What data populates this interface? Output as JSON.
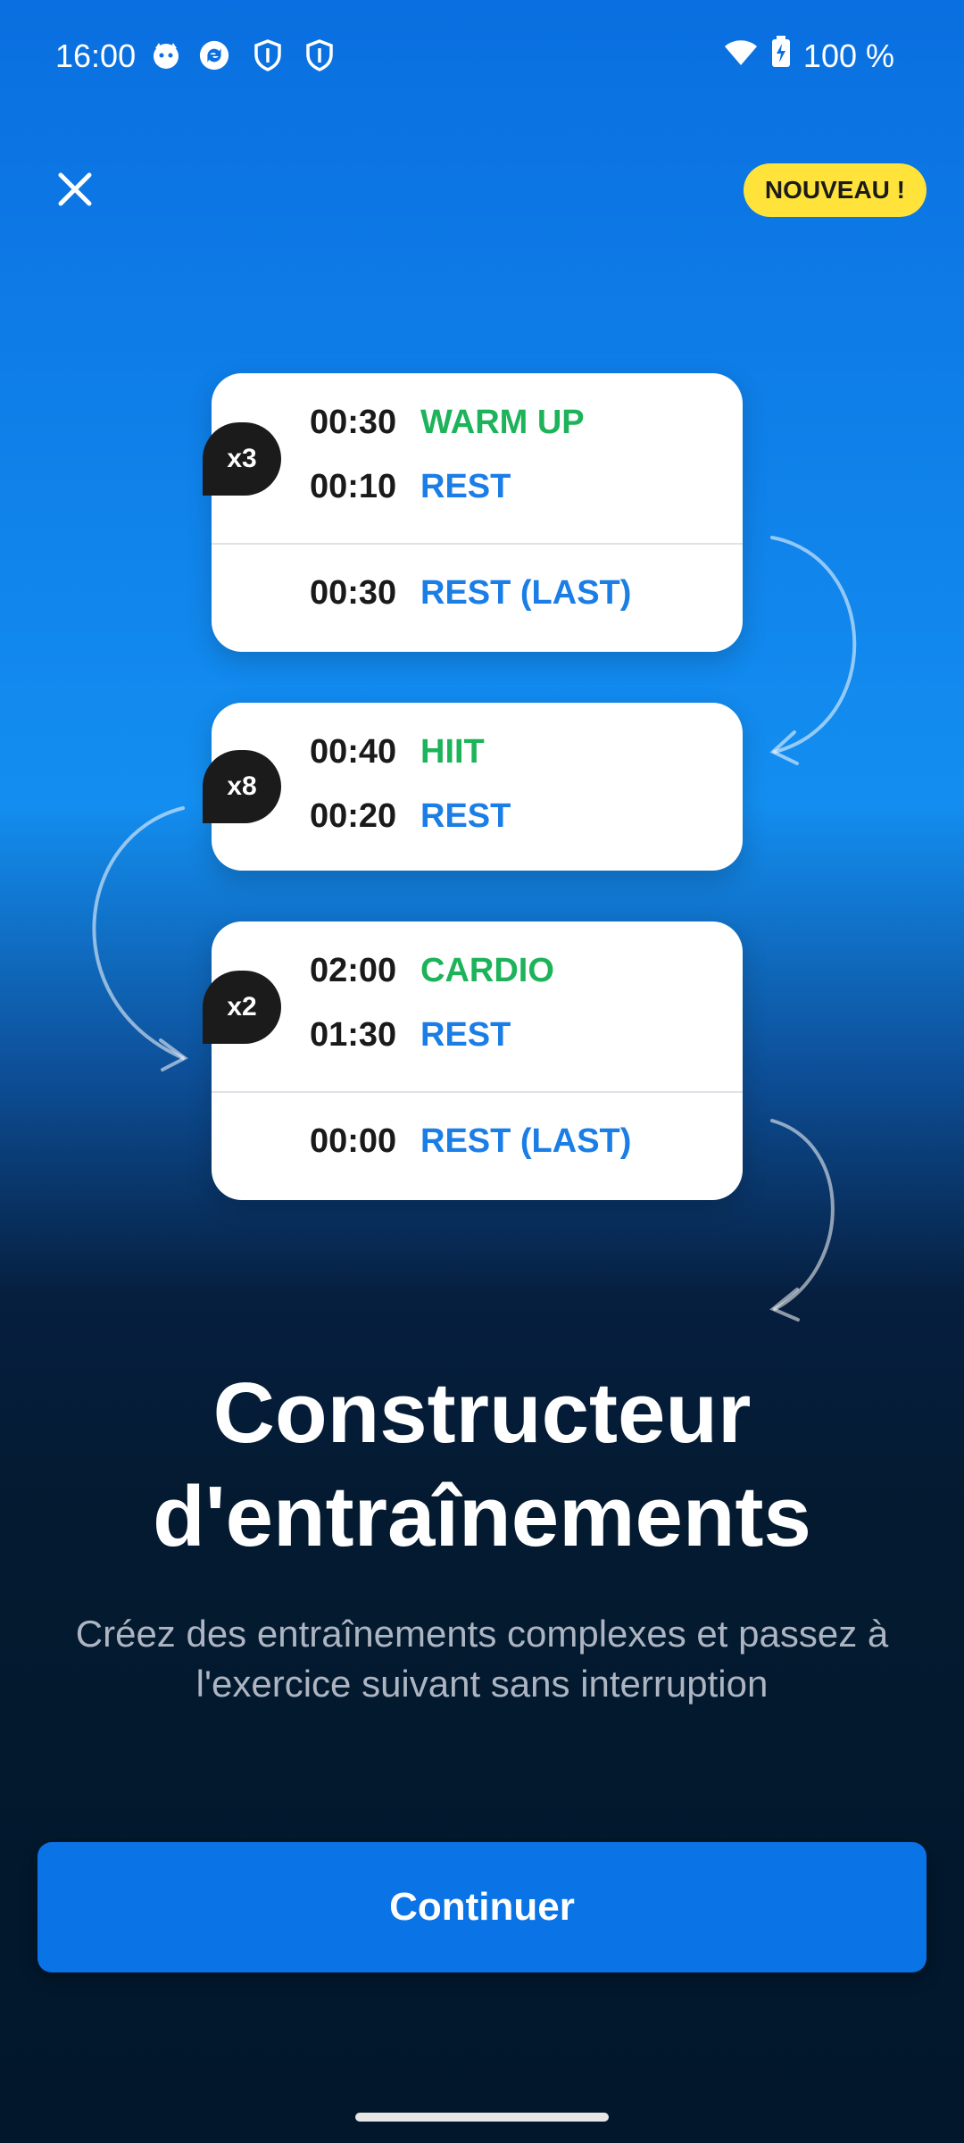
{
  "status_bar": {
    "time": "16:00",
    "battery": "100 %",
    "icons": [
      "cat-notification-icon",
      "sync-icon",
      "shield-icon",
      "shield-icon",
      "wifi-icon",
      "battery-charging-icon"
    ]
  },
  "header": {
    "badge": "NOUVEAU !",
    "close_icon": "close-icon"
  },
  "workout_cards": [
    {
      "repeat": "x3",
      "rows": [
        {
          "time": "00:30",
          "label": "WARM UP",
          "color": "#1db35a"
        },
        {
          "time": "00:10",
          "label": "REST",
          "color": "#1b7ee6"
        }
      ],
      "last": {
        "time": "00:30",
        "label": "REST (LAST)",
        "color": "#1b7ee6"
      }
    },
    {
      "repeat": "x8",
      "rows": [
        {
          "time": "00:40",
          "label": "HIIT",
          "color": "#1db35a"
        },
        {
          "time": "00:20",
          "label": "REST",
          "color": "#1b7ee6"
        }
      ]
    },
    {
      "repeat": "x2",
      "rows": [
        {
          "time": "02:00",
          "label": "CARDIO",
          "color": "#1db35a"
        },
        {
          "time": "01:30",
          "label": "REST",
          "color": "#1b7ee6"
        }
      ],
      "last": {
        "time": "00:00",
        "label": "REST (LAST)",
        "color": "#1b7ee6"
      }
    }
  ],
  "title": "Constructeur d'entraînements",
  "subtitle": "Créez des entraînements complexes et passez à l'exercice suivant sans interruption",
  "cta": {
    "label": "Continuer"
  },
  "colors": {
    "accent": "#0a73e6",
    "badge": "#ffe33a",
    "green": "#1db35a",
    "blue": "#1b7ee6"
  }
}
